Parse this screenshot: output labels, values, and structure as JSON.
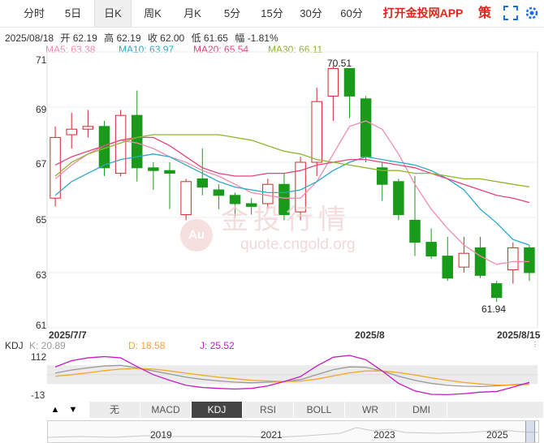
{
  "tabs": [
    {
      "label": "分时"
    },
    {
      "label": "5日"
    },
    {
      "label": "日K"
    },
    {
      "label": "周K"
    },
    {
      "label": "月K"
    },
    {
      "label": "5分"
    },
    {
      "label": "15分"
    },
    {
      "label": "30分"
    },
    {
      "label": "60分"
    }
  ],
  "active_tab": "日K",
  "app_link": "打开金投网APP",
  "strategy_label": "策",
  "ohlc": {
    "date": "2025/08/18",
    "open": "开 62.19",
    "high": "高 62.19",
    "close": "收 62.00",
    "low": "低 61.65",
    "amp": "幅 -1.81%"
  },
  "ma": [
    {
      "label": "MA5: 63.38",
      "color": "#f08cb0"
    },
    {
      "label": "MA10: 63.97",
      "color": "#2aa9c9"
    },
    {
      "label": "MA20: 65.54",
      "color": "#e0457b"
    },
    {
      "label": "MA30: 66.11",
      "color": "#8fb52f"
    }
  ],
  "yticks": [
    "71",
    "69",
    "67",
    "65",
    "63",
    "61"
  ],
  "xticks": [
    "2025/7/7",
    "2025/8",
    "2025/8/15"
  ],
  "high_label": "70.51",
  "low_label": "61.94",
  "watermark": {
    "cn": "金投行情",
    "en": "quote.cngold.org"
  },
  "kdj": {
    "title": "KDJ",
    "k": "K: 20.89",
    "d": "D: 18.58",
    "j": "J: 25.52",
    "ytop": "112",
    "ybottom": "-13",
    "colors": {
      "k": "#999999",
      "d": "#f5a623",
      "j": "#c21cc2"
    }
  },
  "indicators": [
    {
      "label": "无"
    },
    {
      "label": "MACD"
    },
    {
      "label": "KDJ"
    },
    {
      "label": "RSI"
    },
    {
      "label": "BOLL"
    },
    {
      "label": "WR"
    },
    {
      "label": "DMI"
    }
  ],
  "active_indicator": "KDJ",
  "nav_arrows": {
    "left": "▲",
    "right": "▼"
  },
  "years": [
    "2019",
    "2021",
    "2023",
    "2025"
  ],
  "colors": {
    "up": "#d6262b",
    "down": "#1a9a1a"
  },
  "chart_data": {
    "type": "candlestick",
    "ylim": [
      61,
      71
    ],
    "candles": [
      {
        "o": 65.7,
        "c": 67.9,
        "h": 68.3,
        "l": 65.4
      },
      {
        "o": 68.0,
        "c": 68.2,
        "h": 68.8,
        "l": 67.5
      },
      {
        "o": 68.2,
        "c": 68.3,
        "h": 68.9,
        "l": 67.9
      },
      {
        "o": 68.3,
        "c": 66.8,
        "h": 68.5,
        "l": 66.5
      },
      {
        "o": 66.6,
        "c": 68.7,
        "h": 68.9,
        "l": 66.5
      },
      {
        "o": 68.7,
        "c": 66.8,
        "h": 69.6,
        "l": 66.3
      },
      {
        "o": 66.8,
        "c": 66.7,
        "h": 67.0,
        "l": 66.0
      },
      {
        "o": 66.7,
        "c": 66.6,
        "h": 67.0,
        "l": 65.3
      },
      {
        "o": 65.1,
        "c": 66.3,
        "h": 66.4,
        "l": 64.9
      },
      {
        "o": 66.4,
        "c": 66.1,
        "h": 67.5,
        "l": 65.8
      },
      {
        "o": 66.0,
        "c": 65.8,
        "h": 66.2,
        "l": 65.3
      },
      {
        "o": 65.8,
        "c": 65.5,
        "h": 65.9,
        "l": 65.0
      },
      {
        "o": 65.5,
        "c": 65.4,
        "h": 65.7,
        "l": 65.1
      },
      {
        "o": 65.5,
        "c": 66.2,
        "h": 66.4,
        "l": 65.3
      },
      {
        "o": 66.2,
        "c": 65.1,
        "h": 66.6,
        "l": 64.9
      },
      {
        "o": 65.2,
        "c": 67.0,
        "h": 67.2,
        "l": 64.9
      },
      {
        "o": 67.0,
        "c": 69.2,
        "h": 69.7,
        "l": 66.5
      },
      {
        "o": 69.4,
        "c": 70.4,
        "h": 70.51,
        "l": 68.5
      },
      {
        "o": 70.4,
        "c": 69.4,
        "h": 70.4,
        "l": 68.6
      },
      {
        "o": 69.3,
        "c": 67.2,
        "h": 69.4,
        "l": 67.0
      },
      {
        "o": 66.8,
        "c": 66.2,
        "h": 67.0,
        "l": 65.6
      },
      {
        "o": 66.3,
        "c": 65.1,
        "h": 66.4,
        "l": 64.9
      },
      {
        "o": 64.9,
        "c": 64.1,
        "h": 66.5,
        "l": 63.6
      },
      {
        "o": 64.1,
        "c": 63.6,
        "h": 64.6,
        "l": 63.5
      },
      {
        "o": 63.6,
        "c": 62.8,
        "h": 64.3,
        "l": 62.7
      },
      {
        "o": 63.2,
        "c": 63.7,
        "h": 64.3,
        "l": 63.0
      },
      {
        "o": 63.9,
        "c": 62.9,
        "h": 64.3,
        "l": 62.8
      },
      {
        "o": 62.6,
        "c": 62.1,
        "h": 62.7,
        "l": 61.94
      },
      {
        "o": 63.1,
        "c": 63.9,
        "h": 64.1,
        "l": 62.6
      },
      {
        "o": 63.9,
        "c": 63.0,
        "h": 64.0,
        "l": 62.7
      }
    ],
    "ma5": [
      66.4,
      66.9,
      67.3,
      67.6,
      67.8,
      67.7,
      67.5,
      67.2,
      67.0,
      66.7,
      66.5,
      66.2,
      65.9,
      65.8,
      65.7,
      65.7,
      66.3,
      67.3,
      68.3,
      68.5,
      68.2,
      67.3,
      66.2,
      65.3,
      64.6,
      64.0,
      63.6,
      63.3,
      63.4,
      63.4
    ],
    "ma10": [
      65.8,
      66.3,
      66.6,
      66.9,
      67.1,
      67.2,
      67.3,
      67.2,
      66.9,
      66.6,
      66.3,
      66.1,
      66.0,
      65.9,
      65.9,
      66.0,
      66.3,
      66.7,
      67.0,
      67.2,
      67.1,
      67.0,
      66.9,
      66.7,
      66.4,
      66.0,
      65.3,
      64.8,
      64.2,
      64.0
    ],
    "ma20": [
      66.9,
      67.2,
      67.4,
      67.6,
      67.8,
      67.9,
      67.9,
      67.6,
      67.2,
      66.8,
      66.6,
      66.5,
      66.5,
      66.6,
      66.6,
      66.7,
      66.9,
      67.0,
      67.1,
      67.1,
      67.0,
      66.9,
      66.8,
      66.6,
      66.4,
      66.2,
      66.0,
      65.8,
      65.7,
      65.54
    ],
    "ma30": [
      66.5,
      67.0,
      67.3,
      67.5,
      67.7,
      67.9,
      68.0,
      68.0,
      68.0,
      68.0,
      68.0,
      67.9,
      67.8,
      67.6,
      67.4,
      67.3,
      67.1,
      67.0,
      66.9,
      66.8,
      66.7,
      66.7,
      66.6,
      66.6,
      66.5,
      66.4,
      66.4,
      66.3,
      66.2,
      66.11
    ],
    "kdj_k": [
      55,
      65,
      72,
      78,
      80,
      72,
      62,
      52,
      42,
      35,
      30,
      26,
      24,
      26,
      28,
      34,
      50,
      66,
      75,
      74,
      62,
      45,
      32,
      22,
      16,
      13,
      12,
      14,
      18,
      20.89
    ],
    "kdj_d": [
      45,
      50,
      56,
      63,
      68,
      70,
      68,
      62,
      55,
      48,
      42,
      37,
      32,
      30,
      28,
      29,
      36,
      46,
      56,
      62,
      62,
      57,
      49,
      40,
      32,
      25,
      20,
      17,
      17,
      18.58
    ],
    "kdj_j": [
      75,
      95,
      104,
      108,
      104,
      76,
      50,
      32,
      16,
      9,
      6,
      4,
      6,
      14,
      28,
      44,
      78,
      106,
      112,
      98,
      62,
      22,
      -2,
      -13,
      -14,
      -11,
      -6,
      -4,
      10,
      25.52
    ]
  }
}
